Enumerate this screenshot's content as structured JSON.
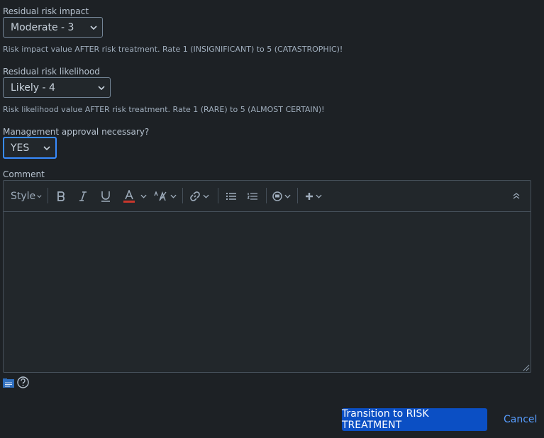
{
  "fields": {
    "impact": {
      "label": "Residual risk impact",
      "value": "Moderate - 3",
      "help": "Risk impact value AFTER risk treatment. Rate 1 (INSIGNIFICANT) to 5 (CATASTROPHIC)!"
    },
    "likelihood": {
      "label": "Residual risk likelihood",
      "value": "Likely - 4",
      "help": "Risk likelihood value AFTER risk treatment. Rate 1 (RARE) to 5 (ALMOST CERTAIN)!"
    },
    "approval": {
      "label": "Management approval necessary?",
      "value": "YES"
    }
  },
  "comment": {
    "label": "Comment",
    "toolbar": {
      "style_label": "Style"
    },
    "value": ""
  },
  "colors": {
    "background": "#1d2125",
    "primary_button": "#0b4fc4",
    "link": "#579dff",
    "focus_border": "#388bff",
    "text_color_swatch": "#c9372c"
  },
  "actions": {
    "submit_label": "Transition to RISK TREATMENT",
    "cancel_label": "Cancel"
  }
}
